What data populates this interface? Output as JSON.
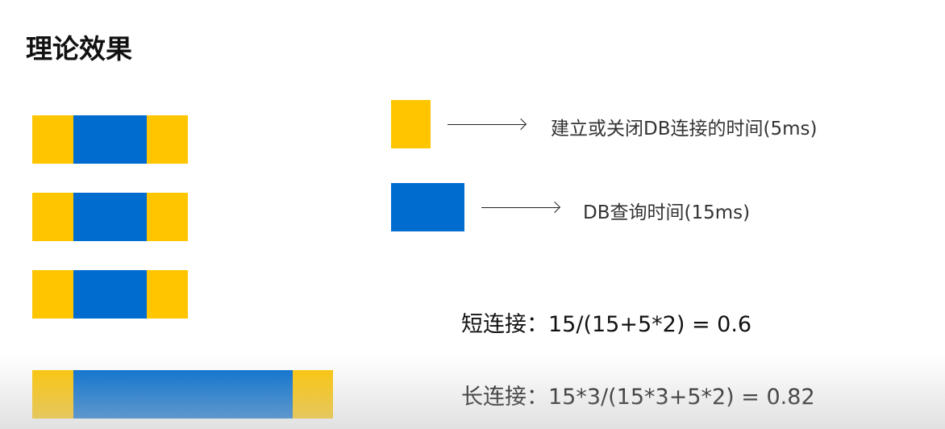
{
  "title": "理论效果",
  "colors": {
    "connect": "#ffc600",
    "query": "#006ccf"
  },
  "legend": [
    {
      "label": "建立或关闭DB连接的时间(5ms)"
    },
    {
      "label": "DB查询时间(15ms)"
    }
  ],
  "formulas": {
    "short": "短连接：15/(15+5*2) = 0.6",
    "long": "长连接：15*3/(15*3+5*2) = 0.82"
  }
}
